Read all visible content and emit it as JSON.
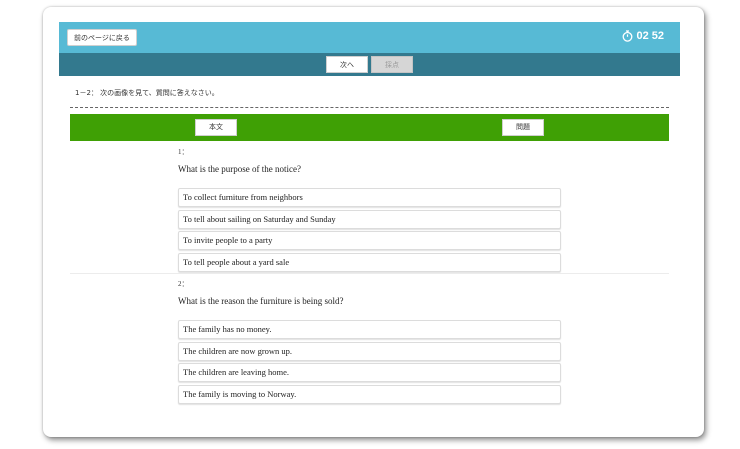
{
  "header": {
    "back_label": "前のページに戻る",
    "timer": "02 52",
    "timer_icon": "stopwatch-icon"
  },
  "nav": {
    "next_label": "次へ",
    "grade_label": "採点"
  },
  "instruction": "1－2： 次の画像を見て、質問に答えなさい。",
  "tabs": {
    "text_label": "本文",
    "questions_label": "問題"
  },
  "questions": [
    {
      "number": "1：",
      "text": "What is the purpose of the notice?",
      "options": [
        "To collect furniture from neighbors",
        "To tell about sailing on Saturday and Sunday",
        "To invite people to a party",
        "To tell people about a yard sale"
      ]
    },
    {
      "number": "2：",
      "text": "What is the reason the furniture is being sold?",
      "options": [
        "The family has no money.",
        "The children are now grown up.",
        "The children are leaving home.",
        "The family is moving to Norway."
      ]
    }
  ],
  "colors": {
    "topbar": "#57bad5",
    "navbar": "#33798e",
    "greenbar": "#3fa005"
  }
}
